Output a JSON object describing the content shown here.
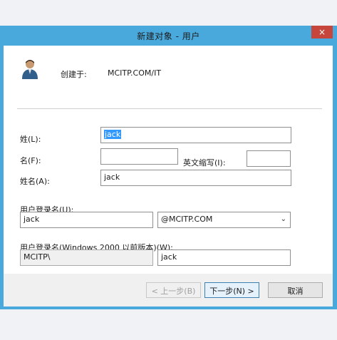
{
  "window": {
    "title": "新建对象 - 用户",
    "close_glyph": "×"
  },
  "header": {
    "icon": "user-icon",
    "created_in_label": "创建于:",
    "created_in_value": "MCITP.COM/IT"
  },
  "form": {
    "last_name_label": "姓(L):",
    "last_name_value": "jack",
    "first_name_label": "名(F):",
    "first_name_value": "",
    "initials_label": "英文缩写(I):",
    "initials_value": "",
    "full_name_label": "姓名(A):",
    "full_name_value": "jack",
    "logon_name_label": "用户登录名(U):",
    "logon_name_value": "jack",
    "upn_suffix_value": "@MCITP.COM",
    "pre2000_label": "用户登录名(Windows 2000 以前版本)(W):",
    "pre2000_domain_value": "MCITP\\",
    "pre2000_name_value": "jack"
  },
  "buttons": {
    "back_label": "< 上一步(B)",
    "next_label": "下一步(N) >",
    "cancel_label": "取消"
  },
  "colors": {
    "title_bar": "#49a9dc",
    "close_button": "#c7463b",
    "selection": "#3399ff"
  }
}
